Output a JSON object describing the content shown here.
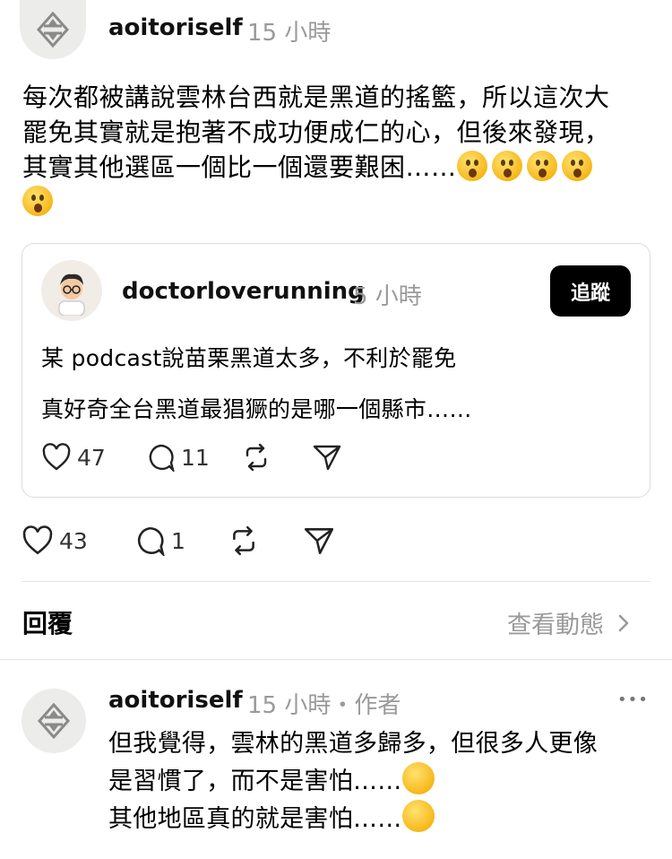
{
  "post": {
    "username": "aoitoriself",
    "time": "15 小時",
    "lines": [
      "每次都被講說雲林台西就是黑道的搖籃，所以這次大",
      "罷免其實就是抱著不成功便成仁的心，但後來發現，",
      "其實其他選區一個比一個還要艱困……"
    ],
    "emoji": [
      "hushed-face-emoji"
    ],
    "likes": "43",
    "comments": "1"
  },
  "quote": {
    "username": "doctorloverunning",
    "time": "5 小時",
    "follow_label": "追蹤",
    "line1": "某 podcast說苗栗黑道太多，不利於罷免",
    "line2": "真好奇全台黑道最猖獗的是哪一個縣市……",
    "likes": "47",
    "comments": "11"
  },
  "replies_header": {
    "title": "回覆",
    "view_activity": "查看動態"
  },
  "reply": {
    "username": "aoitoriself",
    "meta": "15 小時・作者",
    "more": "•••",
    "line1": "但我覺得，雲林的黑道多歸多，但很多人更像",
    "line2": "是習慣了，而不是害怕……",
    "line3": "其他地區真的就是害怕……",
    "emoji": [
      "thinking-face-emoji",
      "melting-face-emoji"
    ]
  },
  "colors": {
    "text": "#000000",
    "muted": "#9a9a9a",
    "border": "#dcdcdc",
    "button": "#000000"
  }
}
